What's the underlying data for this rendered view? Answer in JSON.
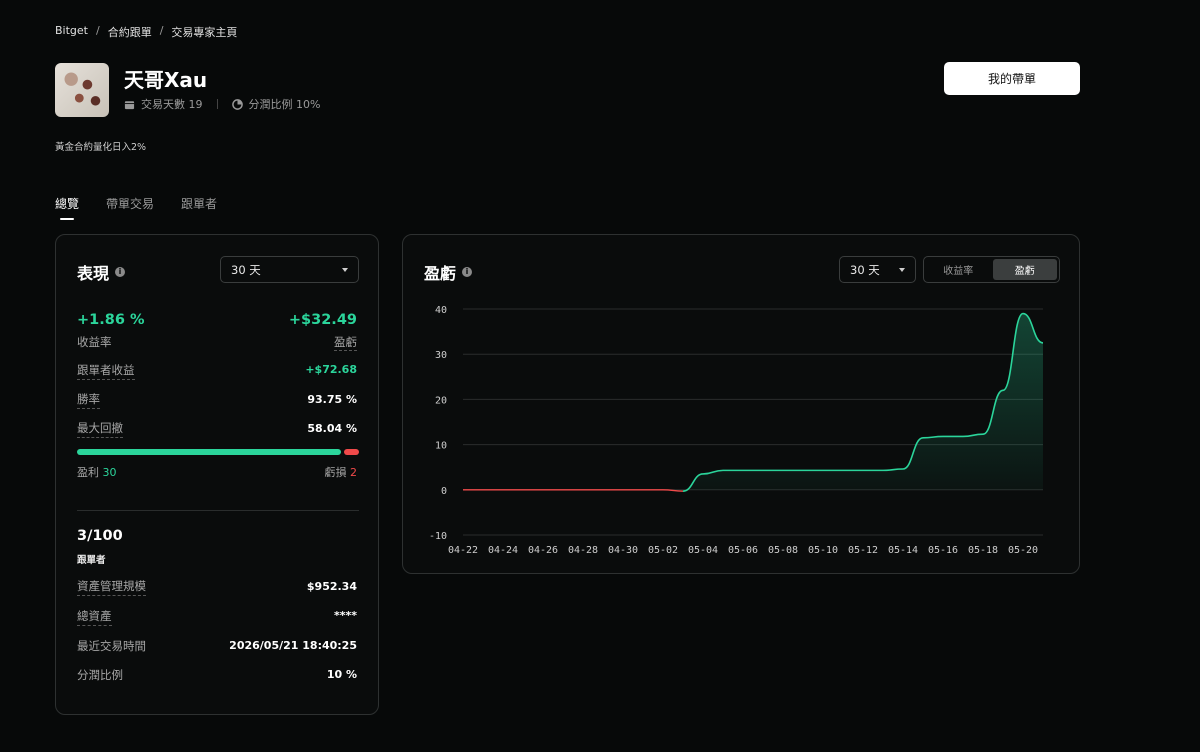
{
  "breadcrumb": [
    "Bitget",
    "合約跟單",
    "交易專家主頁"
  ],
  "profile": {
    "name": "天哥Xau",
    "trading_days_label": "交易天數 19",
    "profit_share_label": "分潤比例 10%",
    "description": "黃金合約量化日入2%"
  },
  "header": {
    "my_copy_button": "我的帶單"
  },
  "tabs": [
    "總覽",
    "帶單交易",
    "跟單者"
  ],
  "performance": {
    "title": "表現",
    "period": "30 天",
    "roi": "+1.86 %",
    "roi_label": "收益率",
    "pnl": "+$32.49",
    "pnl_label": "盈虧",
    "rows": [
      {
        "label": "跟單者收益",
        "value": "+$72.68"
      },
      {
        "label": "勝率",
        "value": "93.75 %"
      },
      {
        "label": "最大回撤",
        "value": "58.04 %"
      }
    ],
    "wins_label": "盈利",
    "wins": "30",
    "losses_label": "虧損",
    "losses": "2",
    "followers": "3/100",
    "followers_label": "跟單者",
    "stats": [
      {
        "label": "資產管理規模",
        "value": "$952.34"
      },
      {
        "label": "總資產",
        "value": "****"
      },
      {
        "label": "最近交易時間",
        "value": "2026/05/21 18:40:25"
      },
      {
        "label": "分潤比例",
        "value": "10 %"
      }
    ]
  },
  "pnl_panel": {
    "title": "盈虧",
    "period": "30 天",
    "toggle": [
      "收益率",
      "盈虧"
    ]
  },
  "colors": {
    "positive": "#2bd59b",
    "negative": "#f04a4a"
  },
  "chart_data": {
    "type": "area",
    "x_tick_labels": [
      "04-22",
      "04-24",
      "04-26",
      "04-28",
      "04-30",
      "05-02",
      "05-04",
      "05-06",
      "05-08",
      "05-10",
      "05-12",
      "05-14",
      "05-16",
      "05-18",
      "05-20"
    ],
    "y_ticks": [
      40,
      30,
      20,
      10,
      0,
      -10
    ],
    "ylim": [
      -10,
      40
    ],
    "x": [
      "04-22",
      "04-23",
      "04-24",
      "04-25",
      "04-26",
      "04-27",
      "04-28",
      "04-29",
      "04-30",
      "05-01",
      "05-02",
      "05-03",
      "05-04",
      "05-05",
      "05-06",
      "05-07",
      "05-08",
      "05-09",
      "05-10",
      "05-11",
      "05-12",
      "05-13",
      "05-14",
      "05-15",
      "05-16",
      "05-17",
      "05-18",
      "05-19",
      "05-20",
      "05-21"
    ],
    "values": [
      0,
      0,
      0,
      0,
      0,
      0,
      0,
      0,
      0,
      0,
      0,
      -0.3,
      3.5,
      4.3,
      4.3,
      4.3,
      4.3,
      4.3,
      4.3,
      4.3,
      4.3,
      4.3,
      4.6,
      11.5,
      11.8,
      11.8,
      12.3,
      22,
      39,
      32.5
    ],
    "grid": true
  }
}
